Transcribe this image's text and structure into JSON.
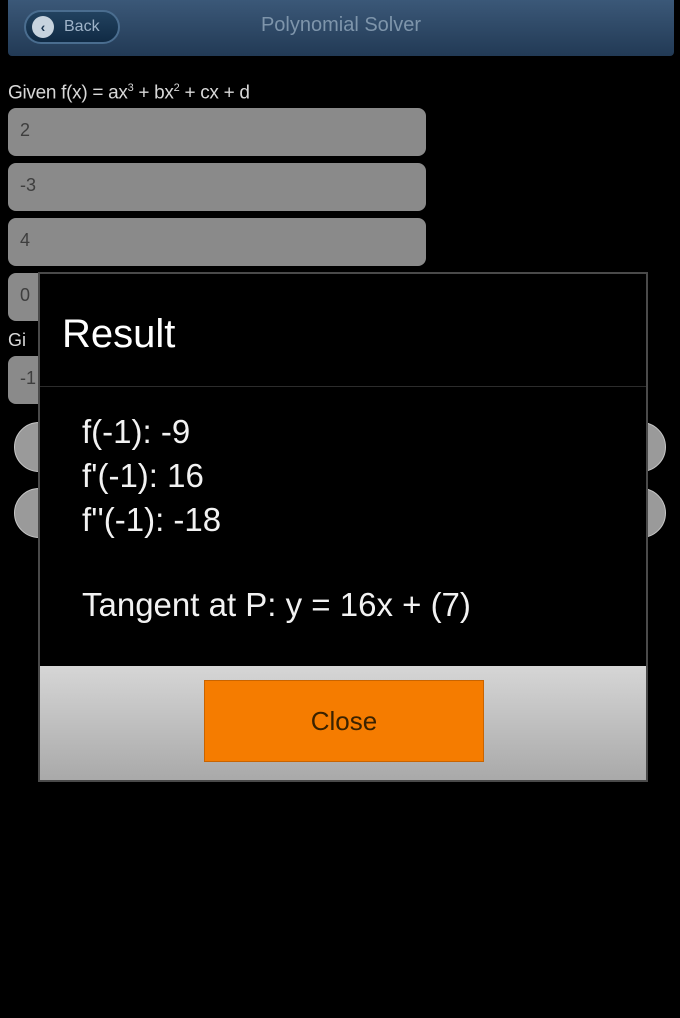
{
  "header": {
    "back_label": "Back",
    "title": "Polynomial Solver"
  },
  "form": {
    "given_prefix": "Given f(x) = ax",
    "given_mid1": " + bx",
    "given_suffix": " + cx + d",
    "exp3": "3",
    "exp2": "2",
    "coefficients": [
      "2",
      "-3",
      "4",
      "0"
    ],
    "point_label": "Gi",
    "point_value": "-1"
  },
  "dialog": {
    "title": "Result",
    "lines": [
      "f(-1): -9",
      "f'(-1): 16",
      "f''(-1): -18"
    ],
    "tangent": "Tangent at P: y = 16x + (7)",
    "close_label": "Close"
  },
  "colors": {
    "accent": "#f57c00",
    "navbar": "#2c4866"
  },
  "icons": {
    "back": "chevron-left-icon"
  }
}
